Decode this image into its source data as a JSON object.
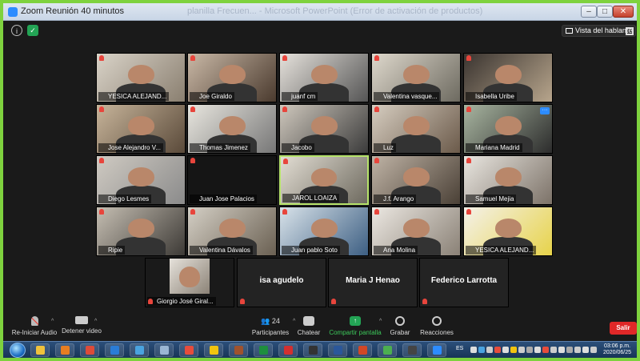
{
  "window": {
    "title": "Zoom Reunión 40 minutos",
    "background_title": "planilla Frecuen... - Microsoft PowerPoint (Error de activación de productos)",
    "min_glyph": "–",
    "max_glyph": "□",
    "close_glyph": "✕"
  },
  "topbar": {
    "info_glyph": "i",
    "shield_glyph": "✓",
    "speaker_view_label": "Vista del hablante"
  },
  "participants": [
    "YESICA ALEJAND...",
    "Joe Giraldo",
    "juanf cm",
    "Valentina vasque...",
    "Isabella Uribe",
    "Jose Alejandro V...",
    "Thomas Jimenez",
    "Jacobo",
    "Luz",
    "Mariana Madrid",
    "Diego Lesmes",
    "Juan Jose Palacios",
    "JAROL LOAIZA",
    "J.f. Arango",
    "Samuel Mejia",
    "Ripie",
    "Valentina Dávalos",
    "Juan pablo Soto",
    "Ana Molina",
    "YESICA ALEJAND...",
    "Giorgio José Giral...",
    "isa agudelo",
    "Maria J Henao",
    "Federico Larrotta"
  ],
  "toolbar": {
    "audio": "Re-Iniciar Audio",
    "video": "Detener video",
    "participants_count": "24",
    "participants": "Participantes",
    "chat": "Chatear",
    "share": "Compartir pantalla",
    "share_glyph": "↑",
    "record": "Grabar",
    "reactions": "Reacciones",
    "leave": "Salir",
    "caret": "^"
  },
  "taskbar": {
    "lang": "ES",
    "time": "03:06 p.m.",
    "date": "2020/06/25"
  },
  "colors": {
    "active_speaker_border": "#b6e36a",
    "leave_button": "#e02828",
    "share_green": "#23a455",
    "zoom_blue": "#2d8cff",
    "outer_border": "#7ed23e"
  }
}
